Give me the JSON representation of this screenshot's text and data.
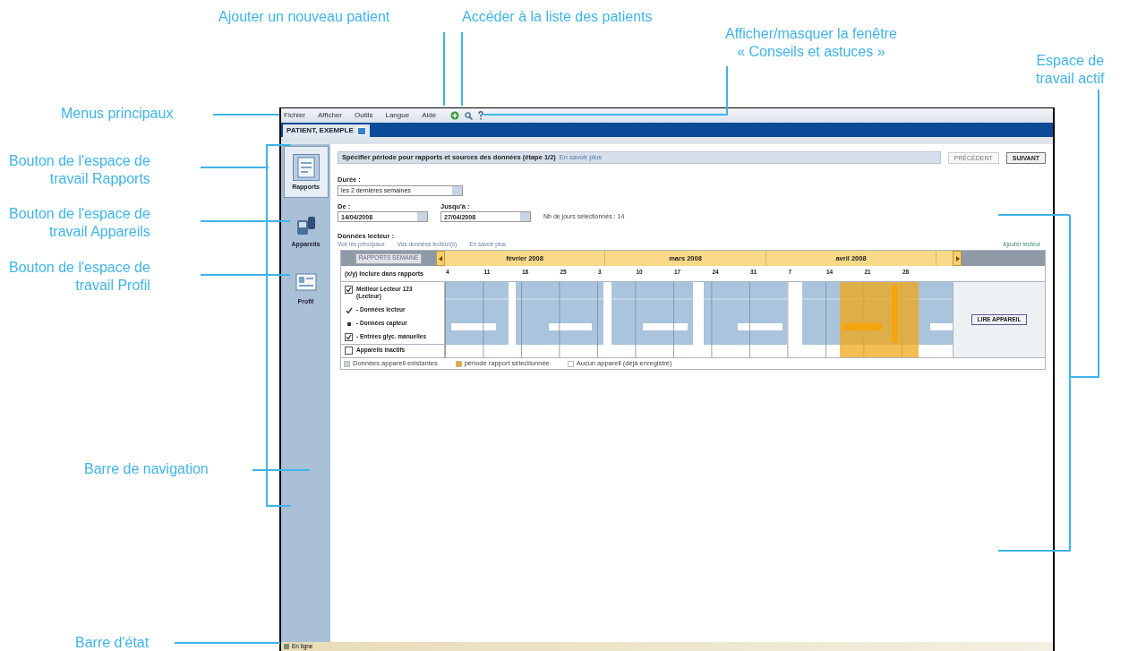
{
  "annotations": [
    {
      "text": "Ajouter un nouveau patient"
    },
    {
      "text": "Accéder à la liste des patients"
    },
    {
      "text": "Afficher/masquer la fenêtre\n« Conseils et astuces »"
    },
    {
      "text": "Espace de\ntravail actif"
    },
    {
      "text": "Menus principaux"
    },
    {
      "text": "Bouton de l'espace de\ntravail Rapports"
    },
    {
      "text": "Bouton de l'espace de\ntravail Appareils"
    },
    {
      "text": "Bouton de l'espace de\ntravail Profil"
    },
    {
      "text": "Barre de navigation"
    },
    {
      "text": "Barre d'état"
    }
  ],
  "app": {
    "menus": [
      "Fichier",
      "Afficher",
      "Outils",
      "Langue",
      "Aide"
    ],
    "patient_tab": {
      "label": "PATIENT, EXEMPLE"
    },
    "nav": [
      {
        "label": "Rapports",
        "selected": true,
        "kind": "reports"
      },
      {
        "label": "Appareils",
        "selected": false,
        "kind": "devices"
      },
      {
        "label": "Profil",
        "selected": false,
        "kind": "profile"
      }
    ],
    "step_header": {
      "title": "Spécifier période pour rapports et sources des données (étape 1/2)",
      "link": "En savoir plus"
    },
    "buttons": [
      {
        "label": "PRÉCÉDENT",
        "disabled": true
      },
      {
        "label": "SUIVANT",
        "disabled": false
      }
    ],
    "duration": {
      "label": "Durée :",
      "value": "les 2 dernières semaines"
    },
    "from": {
      "label": "De :",
      "value": "14/04/2008"
    },
    "to": {
      "label": "Jusqu'à :",
      "value": "27/04/2008"
    },
    "days_selected": "Nb de jours sélectionnés : 14",
    "data_sources": {
      "label": "Données lecteur :",
      "links": [
        "Voir les principaux",
        "Vos données lecteur(s)",
        "En savoir plus"
      ],
      "right_link": "Ajouter lecteur"
    },
    "timeline": {
      "range_button": "RAPPORTS SEMAINE",
      "months": [
        "février 2008",
        "mars 2008",
        "avril 2008"
      ],
      "ticks": [
        "4",
        "11",
        "18",
        "25",
        "3",
        "10",
        "17",
        "24",
        "31",
        "7",
        "14",
        "21",
        "28"
      ],
      "include_label": "(x/y) Inclure dans rapports",
      "device": {
        "name": "Meilleur Lecteur 123 (Lecteur)",
        "checked": true
      },
      "rows": [
        {
          "label": "- Données lecteur",
          "kind": "tick"
        },
        {
          "label": "- Données capteur",
          "kind": "dot"
        },
        {
          "label": "- Entrées glyc. manuelles",
          "kind": "checkbox",
          "checked": true
        }
      ],
      "inactive": {
        "label": "Appareils inactifs",
        "checked": false
      },
      "read_button": "LIRE APPAREIL",
      "legend": [
        {
          "label": "Données appareil existantes",
          "color": "#c5d2de"
        },
        {
          "label": "période rapport sélectionnée",
          "color": "#f0a818"
        },
        {
          "label": "Aucun appareil (déjà enregistré)",
          "color": "#ffffff"
        }
      ]
    }
  },
  "status_bar": "En ligne"
}
